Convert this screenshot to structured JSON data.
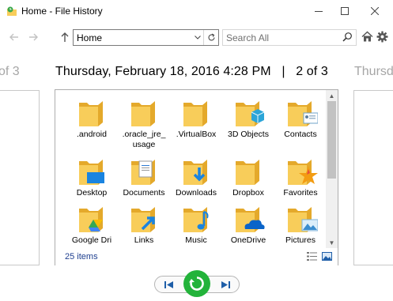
{
  "window": {
    "title": "Home - File History",
    "minimize_icon": "minimize-icon",
    "maximize_icon": "maximize-icon",
    "close_icon": "close-icon"
  },
  "navigation": {
    "address": "Home",
    "search_placeholder": "Search All"
  },
  "version": {
    "date": "Thursday, February 18, 2016 4:28 PM",
    "separator": "|",
    "position": "2 of 3",
    "prev_ghost": "of 3",
    "next_ghost": "Thursda"
  },
  "files": [
    {
      "name": ".android",
      "icon": "folder-icon"
    },
    {
      "name": ".oracle_jre_ usage",
      "icon": "folder-icon"
    },
    {
      "name": ".VirtualBox",
      "icon": "folder-icon"
    },
    {
      "name": "3D Objects",
      "icon": "3d-objects-icon"
    },
    {
      "name": "Contacts",
      "icon": "contacts-icon"
    },
    {
      "name": "Desktop",
      "icon": "desktop-folder-icon"
    },
    {
      "name": "Documents",
      "icon": "documents-folder-icon"
    },
    {
      "name": "Downloads",
      "icon": "downloads-folder-icon"
    },
    {
      "name": "Dropbox",
      "icon": "folder-icon"
    },
    {
      "name": "Favorites",
      "icon": "favorites-folder-icon"
    },
    {
      "name": "Google Dri",
      "icon": "google-drive-folder-icon"
    },
    {
      "name": "Links",
      "icon": "links-folder-icon"
    },
    {
      "name": "Music",
      "icon": "music-folder-icon"
    },
    {
      "name": "OneDrive",
      "icon": "onedrive-folder-icon"
    },
    {
      "name": "Pictures",
      "icon": "pictures-folder-icon"
    }
  ],
  "status": {
    "item_count": "25 items"
  },
  "colors": {
    "folder": "#f8cd5a",
    "folder_dark": "#e4a92b",
    "restore_green": "#23b33a",
    "nav_blue": "#1e5ea8"
  }
}
